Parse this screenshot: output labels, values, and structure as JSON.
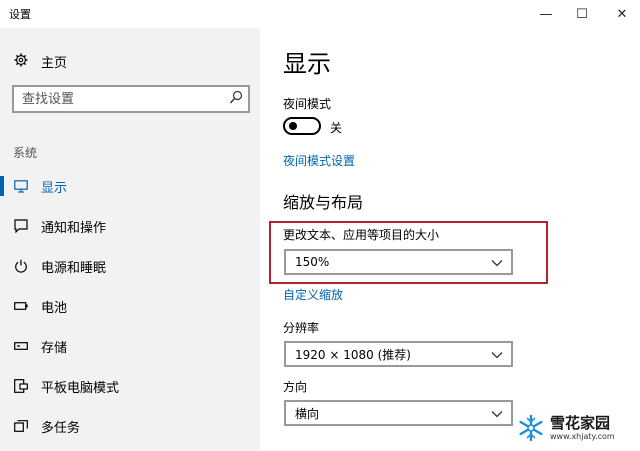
{
  "window": {
    "title": "设置",
    "minimize": "—",
    "maximize": "☐",
    "close": "✕"
  },
  "sidebar": {
    "home_label": "主页",
    "search_placeholder": "查找设置",
    "section_label": "系统",
    "items": [
      {
        "label": "显示",
        "icon": "monitor-icon",
        "active": true
      },
      {
        "label": "通知和操作",
        "icon": "message-icon",
        "active": false
      },
      {
        "label": "电源和睡眠",
        "icon": "power-icon",
        "active": false
      },
      {
        "label": "电池",
        "icon": "battery-icon",
        "active": false
      },
      {
        "label": "存储",
        "icon": "storage-icon",
        "active": false
      },
      {
        "label": "平板电脑模式",
        "icon": "tablet-icon",
        "active": false
      },
      {
        "label": "多任务",
        "icon": "multitask-icon",
        "active": false
      }
    ]
  },
  "main": {
    "title": "显示",
    "night_mode": {
      "label": "夜间模式",
      "state": "关",
      "settings_link": "夜间模式设置"
    },
    "scale_section": {
      "heading": "缩放与布局",
      "text_size_label": "更改文本、应用等项目的大小",
      "text_size_value": "150%",
      "custom_scale_link": "自定义缩放",
      "resolution_label": "分辨率",
      "resolution_value": "1920 × 1080 (推荐)",
      "orientation_label": "方向",
      "orientation_value": "横向"
    }
  },
  "watermark": {
    "name": "雪花家园",
    "url": "www.xhjaty.com"
  },
  "colors": {
    "accent": "#0063b1",
    "highlight_border": "#b0262f",
    "sidebar_bg": "#f2f2f2"
  }
}
